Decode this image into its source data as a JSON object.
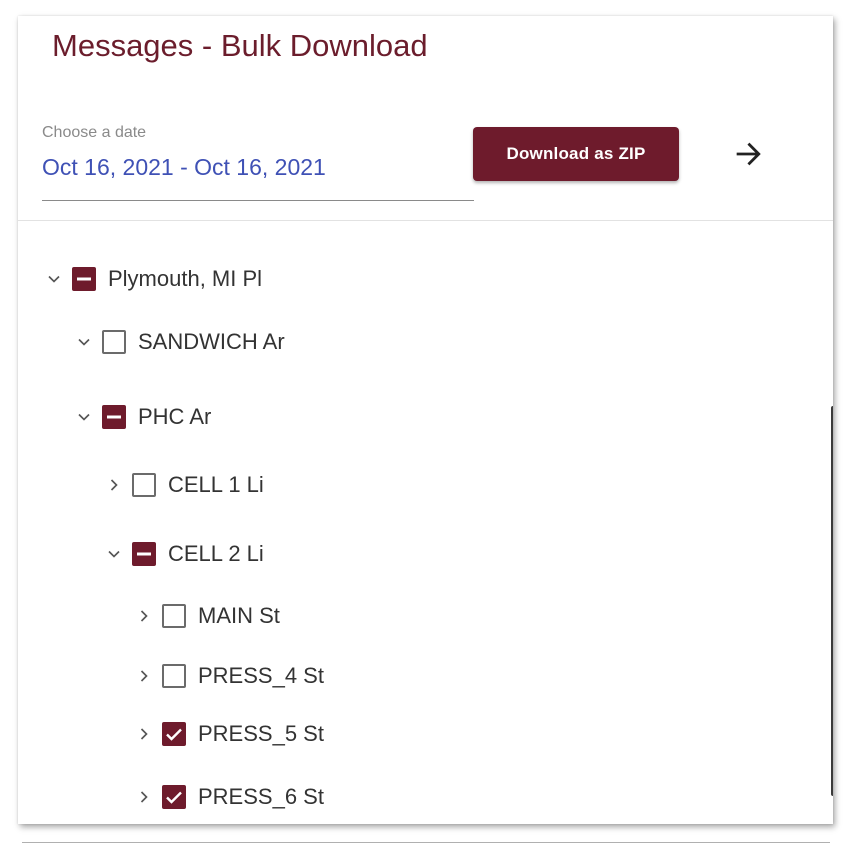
{
  "title": "Messages - Bulk Download",
  "date_field": {
    "label": "Choose a date",
    "value": "Oct 16, 2021 - Oct 16, 2021"
  },
  "download_button": {
    "label": "Download as ZIP"
  },
  "colors": {
    "brand": "#6e1b2c",
    "date_value": "#3f51b5",
    "label_gray": "#8a8a8a"
  },
  "tree": [
    {
      "label": "Plymouth, MI Pl",
      "depth": 0,
      "expanded": true,
      "state": "indeterminate"
    },
    {
      "label": "SANDWICH Ar",
      "depth": 1,
      "expanded": true,
      "state": "unchecked"
    },
    {
      "label": "PHC Ar",
      "depth": 1,
      "expanded": true,
      "state": "indeterminate"
    },
    {
      "label": "CELL 1 Li",
      "depth": 2,
      "expanded": false,
      "state": "unchecked"
    },
    {
      "label": "CELL 2 Li",
      "depth": 2,
      "expanded": true,
      "state": "indeterminate"
    },
    {
      "label": "MAIN St",
      "depth": 3,
      "expanded": false,
      "state": "unchecked"
    },
    {
      "label": "PRESS_4 St",
      "depth": 3,
      "expanded": false,
      "state": "unchecked"
    },
    {
      "label": "PRESS_5 St",
      "depth": 3,
      "expanded": false,
      "state": "checked"
    },
    {
      "label": "PRESS_6 St",
      "depth": 3,
      "expanded": false,
      "state": "checked"
    }
  ]
}
